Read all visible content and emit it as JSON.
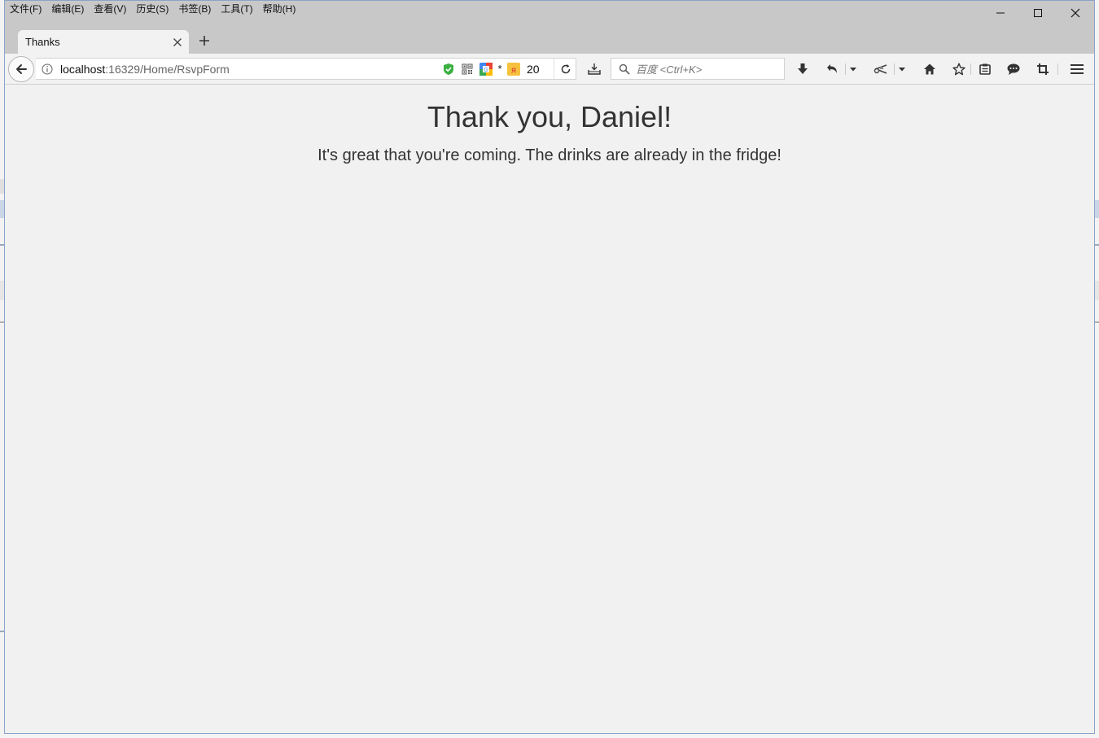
{
  "menubar": {
    "items": [
      "文件(F)",
      "编辑(E)",
      "查看(V)",
      "历史(S)",
      "书签(B)",
      "工具(T)",
      "帮助(H)"
    ]
  },
  "window_controls": {
    "minimize_icon": "minimize-icon",
    "maximize_icon": "maximize-icon",
    "close_icon": "close-icon"
  },
  "tabs": [
    {
      "label": "Thanks",
      "active": true
    }
  ],
  "navbar": {
    "url_host": "localhost",
    "url_path": ":16329/Home/RsvpForm",
    "extension_count": "20",
    "extension_star": "*",
    "search_placeholder": "百度 <Ctrl+K>"
  },
  "page": {
    "heading": "Thank you, Daniel!",
    "message": "It's great that you're coming. The drinks are already in the fridge!"
  },
  "colors": {
    "chrome": "#c8c8c8",
    "toolbar": "#f2f2f2",
    "content_bg": "#f1f1f1",
    "text": "#333333",
    "shield_green": "#3cb043"
  }
}
